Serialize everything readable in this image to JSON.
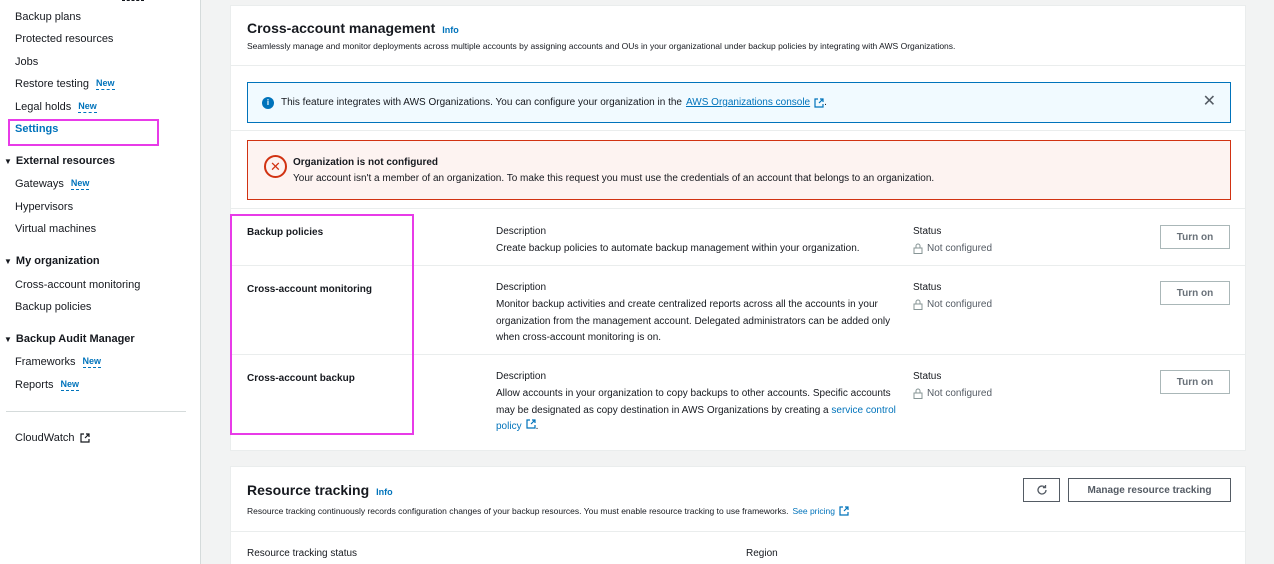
{
  "sidebar": {
    "items_backup": [
      {
        "label": "Backup plans"
      },
      {
        "label": "Protected resources"
      },
      {
        "label": "Jobs"
      },
      {
        "label": "Restore testing",
        "badge": "New"
      },
      {
        "label": "Legal holds",
        "badge": "New"
      },
      {
        "label": "Settings",
        "active": true
      }
    ],
    "external_resources": {
      "title": "External resources",
      "items": [
        {
          "label": "Gateways",
          "badge": "New"
        },
        {
          "label": "Hypervisors"
        },
        {
          "label": "Virtual machines"
        }
      ]
    },
    "my_organization": {
      "title": "My organization",
      "items": [
        {
          "label": "Cross-account monitoring"
        },
        {
          "label": "Backup policies"
        }
      ]
    },
    "audit_manager": {
      "title": "Backup Audit Manager",
      "items": [
        {
          "label": "Frameworks",
          "badge": "New"
        },
        {
          "label": "Reports",
          "badge": "New"
        }
      ]
    },
    "cloudwatch": {
      "label": "CloudWatch"
    }
  },
  "cross_account": {
    "title": "Cross-account management",
    "info": "Info",
    "subtitle": "Seamlessly manage and monitor deployments across multiple accounts by assigning accounts and OUs in your organizational under backup policies by integrating with AWS Organizations.",
    "info_alert": {
      "text": "This feature integrates with AWS Organizations. You can configure your organization in the",
      "link": "AWS Organizations console",
      "suffix": "."
    },
    "error_alert": {
      "title": "Organization is not configured",
      "text": "Your account isn't a member of an organization. To make this request you must use the credentials of an account that belongs to an organization."
    },
    "features": [
      {
        "name": "Backup policies",
        "desc_label": "Description",
        "desc": "Create backup policies to automate backup management within your organization.",
        "status_label": "Status",
        "status": "Not configured",
        "button": "Turn on"
      },
      {
        "name": "Cross-account monitoring",
        "desc_label": "Description",
        "desc": "Monitor backup activities and create centralized reports across all the accounts in your organization from the management account. Delegated administrators can be added only when cross-account monitoring is on.",
        "status_label": "Status",
        "status": "Not configured",
        "button": "Turn on"
      },
      {
        "name": "Cross-account backup",
        "desc_label": "Description",
        "desc": "Allow accounts in your organization to copy backups to other accounts. Specific accounts may be designated as copy destination in AWS Organizations by creating a",
        "desc_link": "service control policy",
        "desc_suffix": ".",
        "status_label": "Status",
        "status": "Not configured",
        "button": "Turn on"
      }
    ]
  },
  "resource_tracking": {
    "title": "Resource tracking",
    "info": "Info",
    "subtitle": "Resource tracking continuously records configuration changes of your backup resources. You must enable resource tracking to use frameworks.",
    "pricing_link": "See pricing",
    "manage_button": "Manage resource tracking",
    "status_label": "Resource tracking status",
    "region_label": "Region"
  },
  "colors": {
    "accent": "#0073bb",
    "error": "#d13212",
    "highlight": "#e83be8"
  }
}
